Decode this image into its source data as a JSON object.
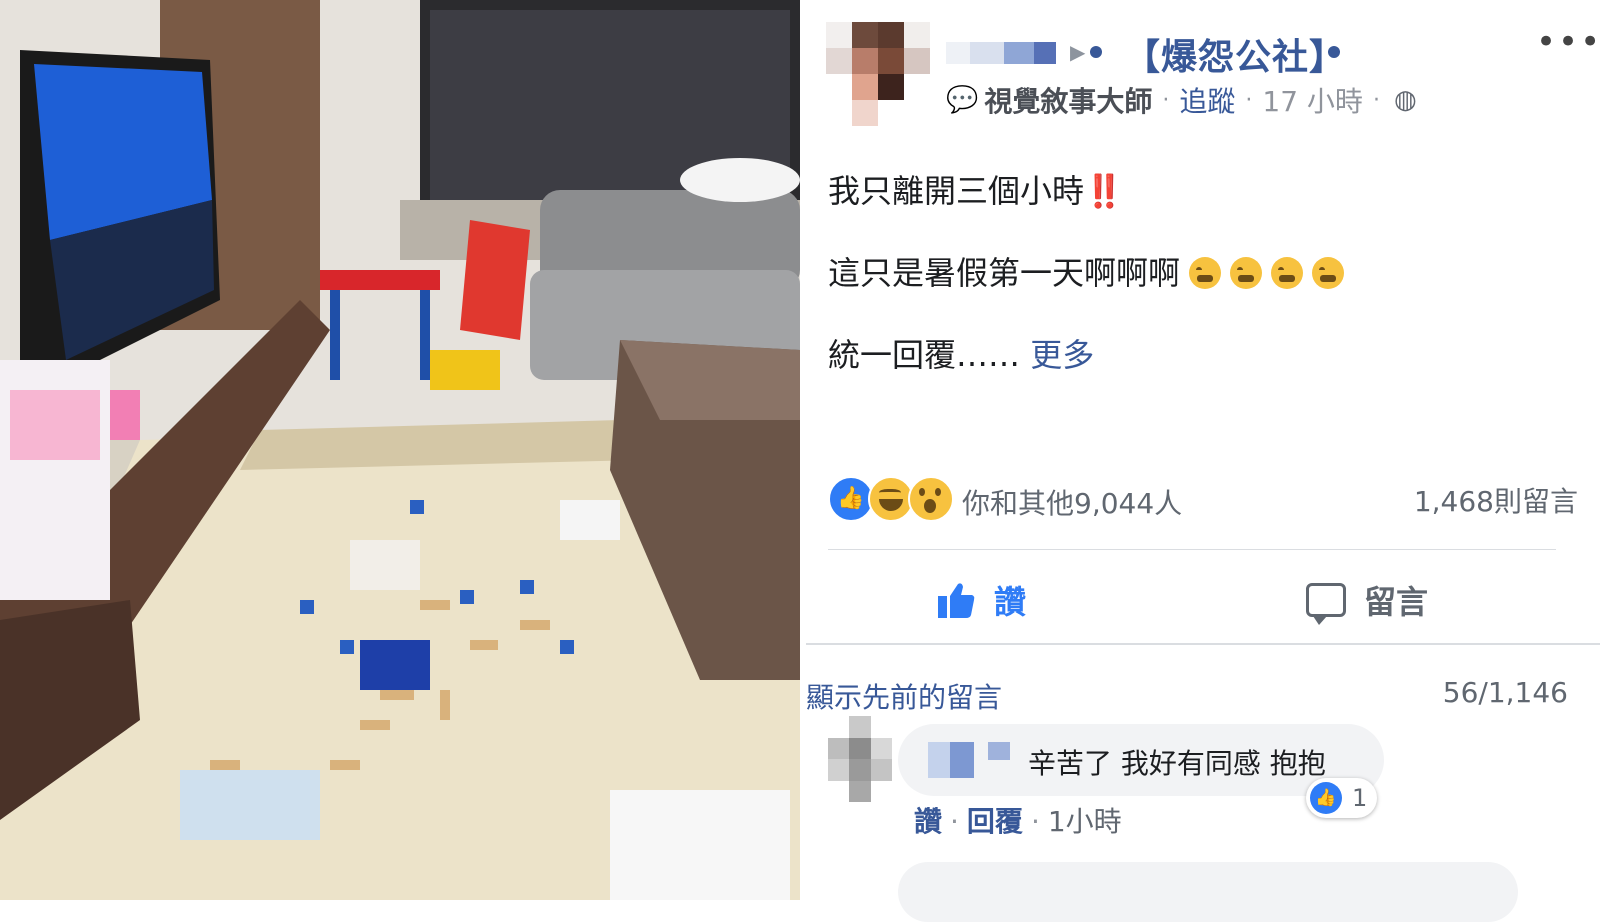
{
  "post": {
    "group_name": "【爆怨公社】",
    "badge_label": "視覺敘事大師",
    "follow_label": "追蹤",
    "time": "17 小時",
    "line1": "我只離開三個小時",
    "line1_emoji": "‼️",
    "line2": "這只是暑假第一天啊啊啊",
    "line2_emoji_count": 4,
    "line3": "統一回覆……",
    "more_label": "更多"
  },
  "reactions": {
    "types": [
      "like",
      "haha",
      "wow"
    ],
    "summary": "你和其他9,044人",
    "comments_total": "1,468則留言"
  },
  "actions": {
    "like_label": "讚",
    "comment_label": "留言"
  },
  "comments": {
    "show_previous": "顯示先前的留言",
    "page_count": "56/1,146",
    "items": [
      {
        "text": "辛苦了 我好有同感 抱抱",
        "like_label": "讚",
        "reply_label": "回覆",
        "time": "1小時",
        "likes": "1"
      }
    ]
  },
  "icons": {
    "more": "more-dots-icon",
    "arrow": "arrow-right-icon",
    "badge": "badge-icon",
    "globe": "globe-icon",
    "thumb": "thumbs-up-icon",
    "bubble": "comment-bubble-icon"
  },
  "colors": {
    "link_blue": "#385898",
    "like_blue": "#2f7cf6",
    "secondary_text": "#606770",
    "divider": "#dadde1"
  }
}
